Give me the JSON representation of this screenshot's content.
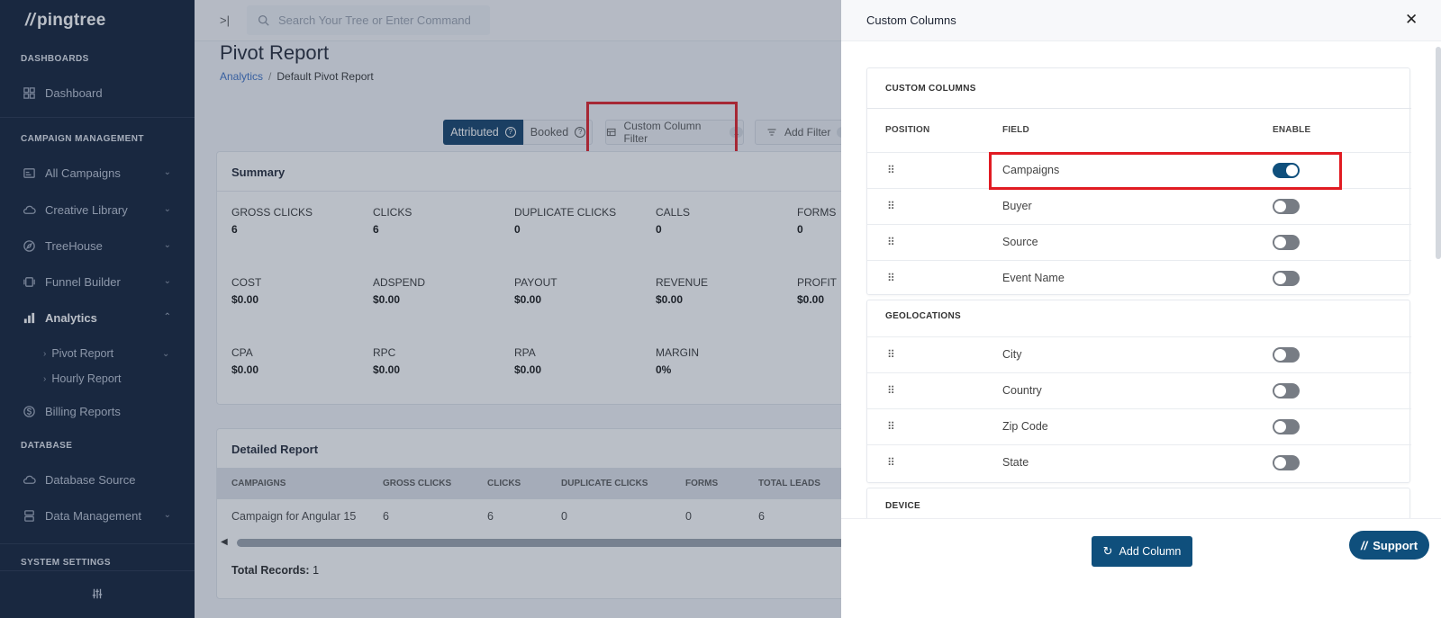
{
  "app": {
    "logo_text": "pingtree",
    "logo_mark": "//"
  },
  "sidebar": {
    "sections": [
      "DASHBOARDS",
      "CAMPAIGN MANAGEMENT",
      "DATABASE",
      "SYSTEM SETTINGS"
    ],
    "items": {
      "dashboard": "Dashboard",
      "all_campaigns": "All Campaigns",
      "creative_library": "Creative Library",
      "treehouse": "TreeHouse",
      "funnel_builder": "Funnel Builder",
      "analytics": "Analytics",
      "pivot_report": "Pivot Report",
      "hourly_report": "Hourly Report",
      "billing_reports": "Billing Reports",
      "database_source": "Database Source",
      "data_management": "Data Management"
    }
  },
  "topbar": {
    "search_placeholder": "Search Your Tree or Enter Command"
  },
  "page": {
    "title": "Pivot Report",
    "breadcrumb": {
      "parent": "Analytics",
      "separator": "/",
      "current": "Default Pivot Report"
    }
  },
  "toolbar": {
    "attributed": "Attributed",
    "booked": "Booked",
    "custom_column_filter": "Custom Column Filter",
    "custom_column_filter_count": "1",
    "add_filter": "Add Filter",
    "add_filter_count": "1"
  },
  "summary": {
    "title": "Summary",
    "metrics": [
      {
        "label": "GROSS CLICKS",
        "value": "6"
      },
      {
        "label": "CLICKS",
        "value": "6"
      },
      {
        "label": "DUPLICATE CLICKS",
        "value": "0"
      },
      {
        "label": "CALLS",
        "value": "0"
      },
      {
        "label": "FORMS",
        "value": "0"
      },
      {
        "label": "COST",
        "value": "$0.00"
      },
      {
        "label": "ADSPEND",
        "value": "$0.00"
      },
      {
        "label": "PAYOUT",
        "value": "$0.00"
      },
      {
        "label": "REVENUE",
        "value": "$0.00"
      },
      {
        "label": "PROFIT",
        "value": "$0.00"
      },
      {
        "label": "CPA",
        "value": "$0.00"
      },
      {
        "label": "RPC",
        "value": "$0.00"
      },
      {
        "label": "RPA",
        "value": "$0.00"
      },
      {
        "label": "MARGIN",
        "value": "0%"
      }
    ]
  },
  "detailed": {
    "title": "Detailed Report",
    "columns": [
      "CAMPAIGNS",
      "GROSS CLICKS",
      "CLICKS",
      "DUPLICATE CLICKS",
      "FORMS",
      "TOTAL LEADS"
    ],
    "rows": [
      [
        "Campaign for Angular 15",
        "6",
        "6",
        "0",
        "0",
        "6"
      ]
    ],
    "total_label": "Total Records:",
    "total_value": "1"
  },
  "panel": {
    "title": "Custom Columns",
    "columns": {
      "position": "POSITION",
      "field": "FIELD",
      "enable": "ENABLE"
    },
    "groups": [
      {
        "title": "CUSTOM COLUMNS",
        "fields": [
          {
            "name": "Campaigns",
            "enabled": true
          },
          {
            "name": "Buyer",
            "enabled": false
          },
          {
            "name": "Source",
            "enabled": false
          },
          {
            "name": "Event Name",
            "enabled": false
          }
        ]
      },
      {
        "title": "GEOLOCATIONS",
        "fields": [
          {
            "name": "City",
            "enabled": false
          },
          {
            "name": "Country",
            "enabled": false
          },
          {
            "name": "Zip Code",
            "enabled": false
          },
          {
            "name": "State",
            "enabled": false
          }
        ]
      },
      {
        "title": "DEVICE",
        "fields": []
      }
    ],
    "add_column": "Add Column"
  },
  "support": {
    "label": "Support"
  },
  "colors": {
    "sidebar_bg": "#0c1a33",
    "primary": "#0f4f7c",
    "highlight": "#e11b22"
  }
}
